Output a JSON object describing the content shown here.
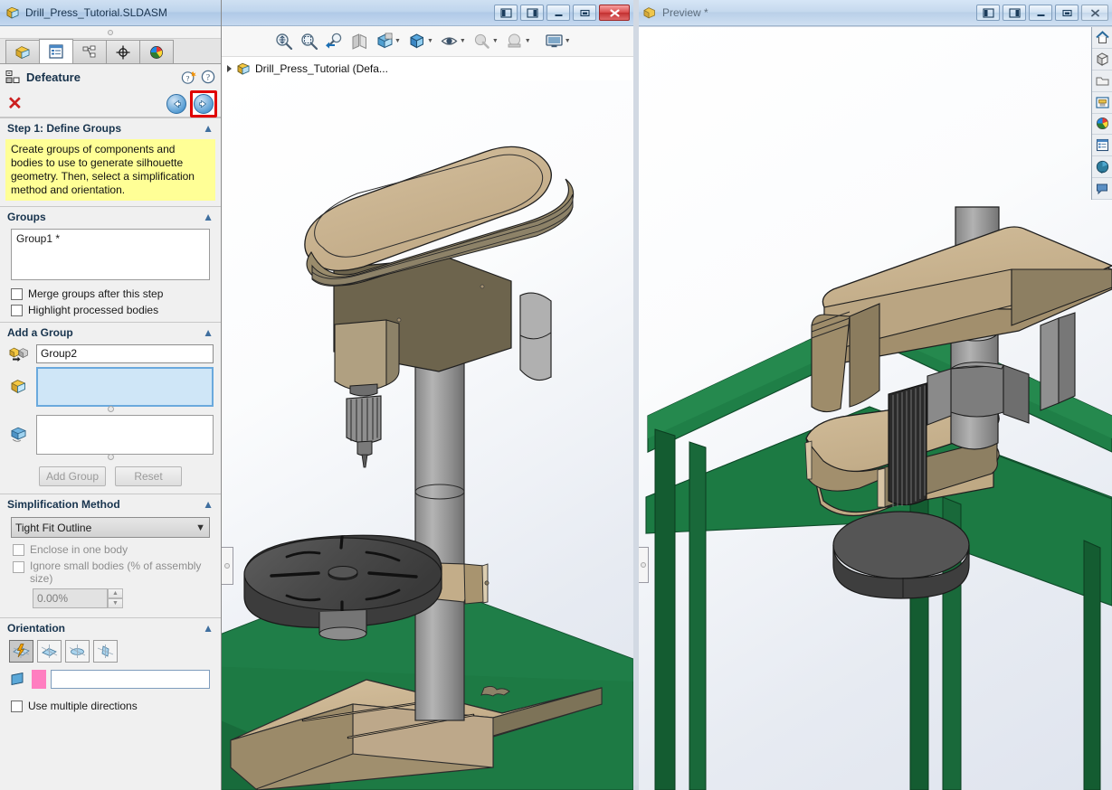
{
  "left_panel": {
    "window_title": "Drill_Press_Tutorial.SLDASM",
    "tabs": [
      {
        "name": "feature-manager-tab",
        "icon": "yellow-cube-icon"
      },
      {
        "name": "property-manager-tab",
        "icon": "blue-list-icon"
      },
      {
        "name": "configuration-manager-tab",
        "icon": "config-tree-icon"
      },
      {
        "name": "dimxpert-manager-tab",
        "icon": "crosshair-icon"
      },
      {
        "name": "display-manager-tab",
        "icon": "color-sphere-icon"
      }
    ],
    "command_title": "Defeature",
    "help_icons": [
      "whats-new-help-icon",
      "help-icon"
    ],
    "cancel_label": "✕",
    "nav": {
      "back": "back-arrow-icon",
      "next": "next-arrow-icon"
    },
    "step1": {
      "header": "Step 1: Define Groups",
      "hint": "Create groups of components and bodies to use to generate silhouette geometry. Then, select a simplification method and orientation."
    },
    "groups": {
      "header": "Groups",
      "items": [
        "Group1 *"
      ],
      "merge_label": "Merge groups after this step",
      "highlight_label": "Highlight processed bodies"
    },
    "add_group": {
      "header": "Add a Group",
      "name_value": "Group2",
      "name_icon": "group-name-icon",
      "components_icon": "yellow-component-icon",
      "components_value": "",
      "bodies_icon": "blue-body-icon",
      "bodies_value": "",
      "add_button": "Add Group",
      "reset_button": "Reset"
    },
    "simplification": {
      "header": "Simplification Method",
      "selected": "Tight Fit Outline",
      "enclose_label": "Enclose in one body",
      "ignore_label": "Ignore small bodies (% of assembly size)",
      "percent_value": "0.00%"
    },
    "orientation": {
      "header": "Orientation",
      "icons": [
        "auto-orientation-icon",
        "orient-x-icon",
        "orient-y-icon",
        "orient-z-icon"
      ],
      "plane_icon": "blue-plane-icon",
      "direction_value": ""
    },
    "multi_dir_label": "Use multiple directions"
  },
  "doc_window": {
    "title": "",
    "window_buttons": [
      "restore-left-icon",
      "restore-right-icon",
      "minimize-icon",
      "maximize-icon",
      "close-icon"
    ],
    "toolbar_icons": [
      "zoom-to-fit-icon",
      "zoom-to-area-icon",
      "previous-view-icon",
      "section-view-icon",
      "view-orientation-icon",
      "display-style-icon",
      "hide-show-items-icon",
      "edit-appearance-icon",
      "apply-scene-icon",
      "view-setting-icon"
    ],
    "tree_item": "Drill_Press_Tutorial  (Defa...",
    "tree_icon": "assembly-icon",
    "overlay_mark": "✖"
  },
  "preview_window": {
    "title": "Preview *",
    "icon": "preview-assembly-icon",
    "window_buttons": [
      "restore-left-icon",
      "restore-right-icon",
      "minimize-icon",
      "maximize-icon",
      "close-icon"
    ],
    "rail_icons": [
      "home-view-icon",
      "appearances-icon",
      "folder-icon",
      "part-library-icon",
      "color-wheel-icon",
      "document-list-icon",
      "refresh-view-icon",
      "comment-icon"
    ]
  },
  "colors": {
    "tan": "#c9b391",
    "tan_dark": "#8d8268",
    "grey_metal": "#9a9a9a",
    "dark_grey": "#4f4f4f",
    "table_green": "#1e7a42",
    "table_green_dark": "#13572e",
    "accent_blue": "#2e7ab8",
    "hint_yellow": "#ffff96",
    "highlight_red": "#e00000",
    "pink_swatch": "#ff7ec0"
  }
}
